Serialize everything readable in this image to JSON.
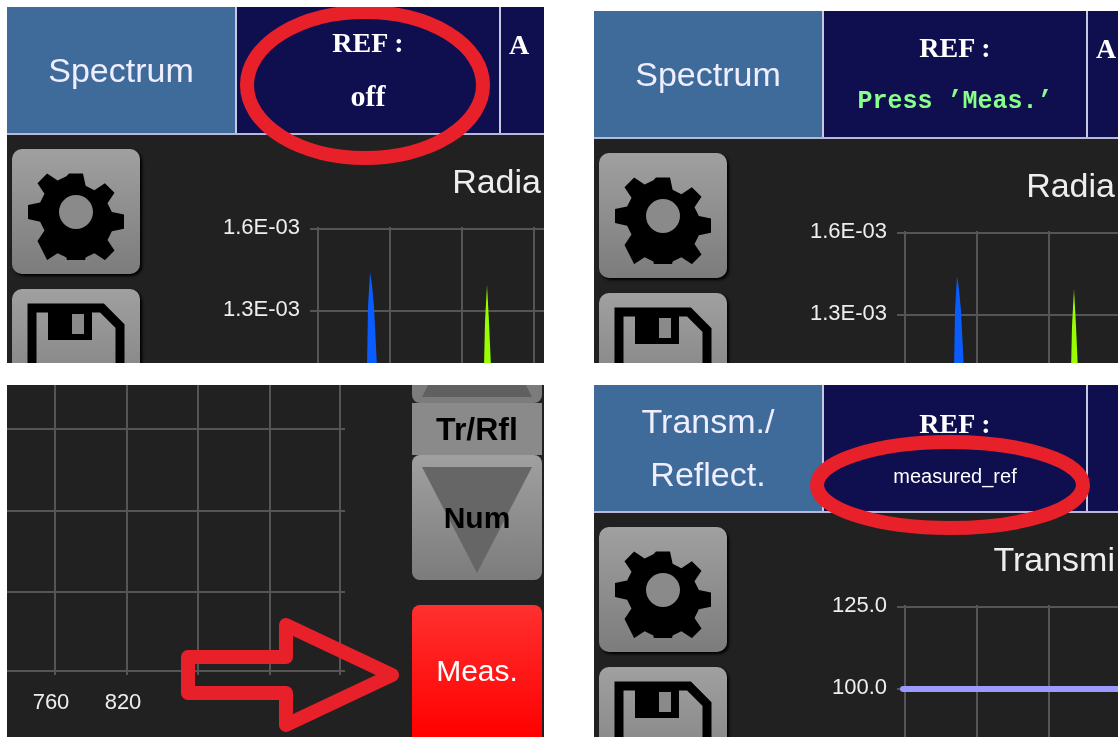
{
  "panels": [
    {
      "kind": "header",
      "mode_tab": "Spectrum",
      "ref": {
        "label": "REF :",
        "value": "off",
        "kind": "plain"
      },
      "next_tab": "A",
      "chart_title": "Radia",
      "yticks": [
        "1.6E-03",
        "1.3E-03"
      ],
      "plot": {
        "kind": "peaks"
      },
      "annotation": {
        "kind": "cell"
      }
    },
    {
      "kind": "header",
      "mode_tab": "Spectrum",
      "ref": {
        "label": "REF :",
        "value": "Press ’Meas.’",
        "kind": "prompt"
      },
      "next_tab": "A",
      "chart_title": "Radia",
      "yticks": [
        "1.6E-03",
        "1.3E-03"
      ],
      "plot": {
        "kind": "peaks"
      }
    },
    {
      "kind": "controls",
      "xticks": [
        "760",
        "820"
      ],
      "buttons": [
        {
          "label": "Tr/Rfl",
          "kind": "label"
        },
        {
          "label": "Num",
          "kind": "down"
        },
        {
          "label": "Meas.",
          "kind": "measure"
        }
      ],
      "annotation": {
        "kind": "arrow"
      }
    },
    {
      "kind": "header",
      "mode_tab": "Transm./ Reflect.",
      "ref": {
        "label": "REF :",
        "value": "measured_ref",
        "kind": "file"
      },
      "chart_title": "Transmi",
      "yticks": [
        "125.0",
        "100.0"
      ],
      "plot": {
        "kind": "flat"
      },
      "annotation": {
        "kind": "value"
      }
    }
  ]
}
